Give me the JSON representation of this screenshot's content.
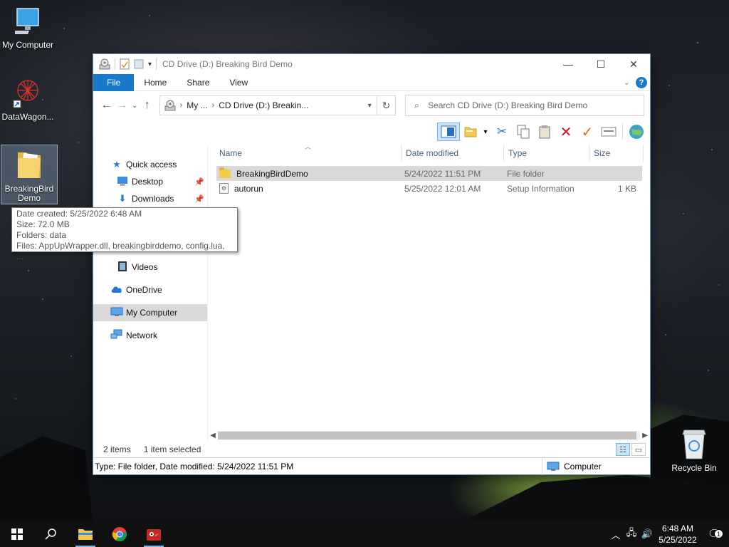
{
  "desktop": {
    "icons": [
      {
        "label": "My Computer",
        "icon": "monitor-icon"
      },
      {
        "label": "DataWagon...",
        "icon": "datawagon-app-icon"
      },
      {
        "label": "BreakingBird Demo",
        "icon": "folder-icon"
      },
      {
        "label": "Recycle Bin",
        "icon": "recycle-bin-icon"
      }
    ]
  },
  "window": {
    "title": "CD Drive (D:) Breaking Bird Demo",
    "controls": {
      "minimize": "—",
      "maximize": "☐",
      "close": "✕"
    },
    "ribbon_tabs": [
      "File",
      "Home",
      "Share",
      "View"
    ],
    "help": "?",
    "address": {
      "crumbs": [
        "My ...",
        "CD Drive (D:) Breakin..."
      ]
    },
    "search_placeholder": "Search CD Drive (D:) Breaking Bird Demo"
  },
  "navpane": {
    "items": [
      {
        "label": "Quick access",
        "icon": "star-icon"
      },
      {
        "label": "Desktop",
        "icon": "desktop-icon"
      },
      {
        "label": "Downloads",
        "icon": "download-icon"
      },
      {
        "label": "Videos",
        "icon": "videos-icon"
      },
      {
        "label": "OneDrive",
        "icon": "cloud-icon"
      },
      {
        "label": "My Computer",
        "icon": "computer-icon"
      },
      {
        "label": "Network",
        "icon": "network-icon"
      }
    ]
  },
  "columns": [
    "Name",
    "Date modified",
    "Type",
    "Size"
  ],
  "files": [
    {
      "name": "BreakingBirdDemo",
      "date": "5/24/2022 11:51 PM",
      "type": "File folder",
      "size": "",
      "icon": "folder-icon"
    },
    {
      "name": "autorun",
      "date": "5/25/2022 12:01 AM",
      "type": "Setup Information",
      "size": "1 KB",
      "icon": "setup-info-icon"
    }
  ],
  "status": {
    "items": "2 items",
    "selected": "1 item selected",
    "detail": "Type: File folder, Date modified: 5/24/2022 11:51 PM",
    "location": "Computer"
  },
  "tooltip": {
    "line1": "Date created: 5/25/2022 6:48 AM",
    "line2": "Size: 72.0 MB",
    "line3": "Folders: data",
    "line4": "Files: AppUpWrapper.dll, breakingbirddemo, config.lua, ..."
  },
  "taskbar": {
    "clock_time": "6:48 AM",
    "clock_date": "5/25/2022",
    "notification_count": "1"
  },
  "colors": {
    "accent": "#1979ca",
    "selection": "#d9d9d9",
    "folder": "#f2c94c"
  }
}
